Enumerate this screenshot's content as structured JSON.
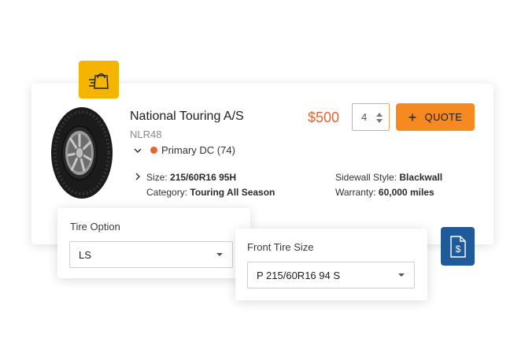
{
  "product": {
    "title": "National Touring A/S",
    "sku": "NLR48",
    "location": "Primary DC (74)",
    "price": "$500",
    "quantity": "4",
    "quote_label": "QUOTE",
    "specs": {
      "size_label": "Size:",
      "size_value": "215/60R16 95H",
      "category_label": "Category:",
      "category_value": "Touring All Season",
      "sidewall_label": "Sidewall Style:",
      "sidewall_value": "Blackwall",
      "warranty_label": "Warranty:",
      "warranty_value": "60,000 miles"
    }
  },
  "tire_option": {
    "label": "Tire Option",
    "value": "LS"
  },
  "front_tire_size": {
    "label": "Front Tire Size",
    "value": "P 215/60R16 94 S"
  },
  "icons": {
    "badge_top": "shopping-bag-icon",
    "badge_bottom": "invoice-dollar-icon",
    "location_chevron": "chevron-down-icon",
    "spec_chevron": "chevron-right-icon"
  },
  "colors": {
    "accent_orange": "#f78a1e",
    "price_orange": "#e8642c",
    "badge_yellow": "#f5b400",
    "badge_blue": "#1f5a9a"
  }
}
